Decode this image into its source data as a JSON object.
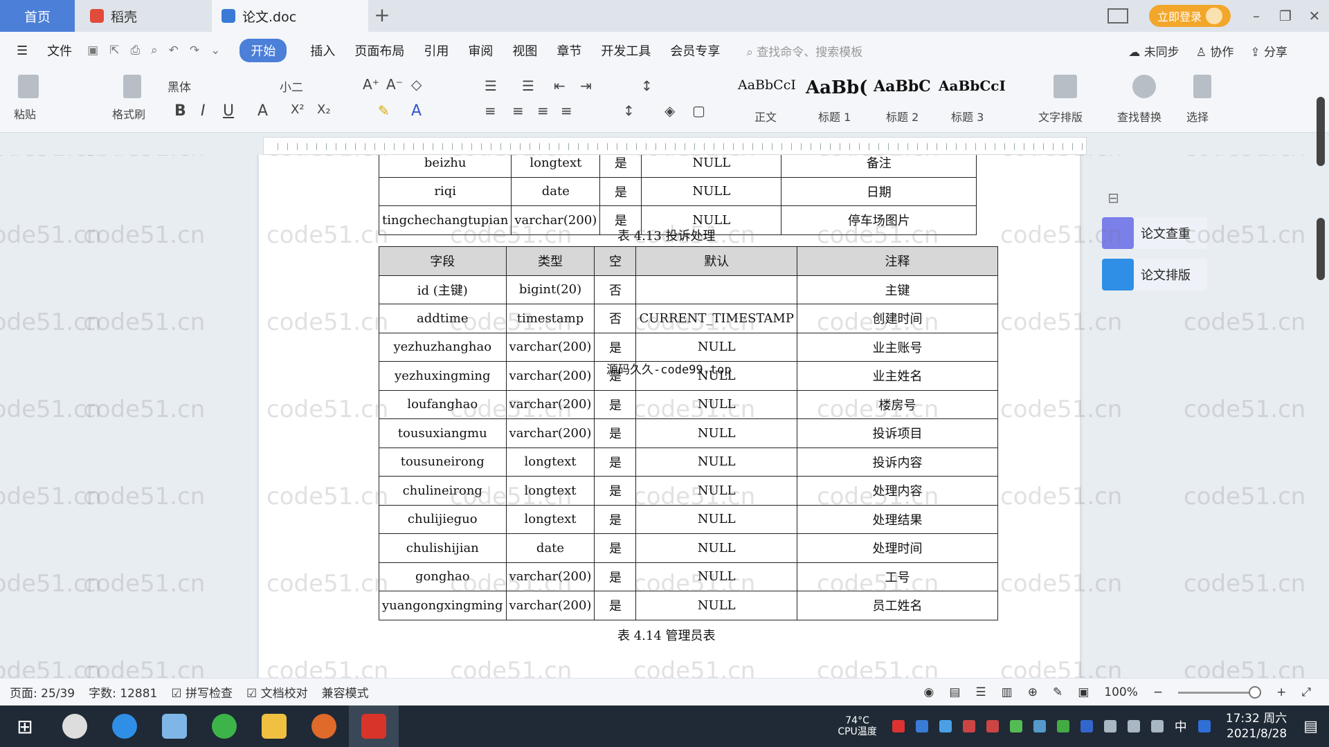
{
  "tabs": {
    "home": "首页",
    "daoke": "稻壳",
    "doc": "论文.doc"
  },
  "window": {
    "login_button": "立即登录"
  },
  "menu": {
    "file": "文件",
    "items": [
      "开始",
      "插入",
      "页面布局",
      "引用",
      "审阅",
      "视图",
      "章节",
      "开发工具",
      "会员专享"
    ],
    "search_placeholder": "查找命令、搜索模板",
    "sync": "未同步",
    "collab": "协作",
    "share": "分享"
  },
  "ribbon": {
    "paste": "粘贴",
    "format_painter": "格式刷",
    "font": "黑体",
    "font_size": "小二",
    "style_previews": [
      "AaBbCcI",
      "AaBb(",
      "AaBbC",
      "AaBbCcI"
    ],
    "style_names": [
      "正文",
      "标题 1",
      "标题 2",
      "标题 3"
    ],
    "text_layout": "文字排版",
    "find_replace": "查找替换",
    "select": "选择"
  },
  "prev_table": {
    "rows": [
      [
        "beizhu",
        "longtext",
        "是",
        "NULL",
        "备注"
      ],
      [
        "riqi",
        "date",
        "是",
        "NULL",
        "日期"
      ],
      [
        "tingchechangtupian",
        "varchar(200)",
        "是",
        "NULL",
        "停车场图片"
      ]
    ]
  },
  "captions": {
    "t413": "表 4.13  投诉处理",
    "t414": "表 4.14  管理员表"
  },
  "main_table": {
    "headers": [
      "字段",
      "类型",
      "空",
      "默认",
      "注释"
    ],
    "rows": [
      [
        "id (主键)",
        "bigint(20)",
        "否",
        "",
        "主键"
      ],
      [
        "addtime",
        "timestamp",
        "否",
        "CURRENT_TIMESTAMP",
        "创建时间"
      ],
      [
        "yezhuzhanghao",
        "varchar(200)",
        "是",
        "NULL",
        "业主账号"
      ],
      [
        "yezhuxingming",
        "varchar(200)",
        "是",
        "NULL",
        "业主姓名"
      ],
      [
        "loufanghao",
        "varchar(200)",
        "是",
        "NULL",
        "楼房号"
      ],
      [
        "tousuxiangmu",
        "varchar(200)",
        "是",
        "NULL",
        "投诉项目"
      ],
      [
        "tousuneirong",
        "longtext",
        "是",
        "NULL",
        "投诉内容"
      ],
      [
        "chulineirong",
        "longtext",
        "是",
        "NULL",
        "处理内容"
      ],
      [
        "chulijieguo",
        "longtext",
        "是",
        "NULL",
        "处理结果"
      ],
      [
        "chulishijian",
        "date",
        "是",
        "NULL",
        "处理时间"
      ],
      [
        "gonghao",
        "varchar(200)",
        "是",
        "NULL",
        "工号"
      ],
      [
        "yuangongxingming",
        "varchar(200)",
        "是",
        "NULL",
        "员工姓名"
      ]
    ]
  },
  "overlay_text": "源码久久-code99.top",
  "watermark": "code51.cn",
  "side_panel": {
    "check": "论文查重",
    "format": "论文排版"
  },
  "status": {
    "page": "页面: 25/39",
    "words": "字数: 12881",
    "spell": "拼写检查",
    "proof": "文档校对",
    "compat": "兼容模式",
    "zoom": "100%"
  },
  "taskbar": {
    "temp": "74°C",
    "cpu": "CPU温度",
    "ime": "中",
    "time": "17:32 周六",
    "date": "2021/8/28"
  },
  "colors": {
    "accent": "#4b7fd8",
    "login": "#f2a72b",
    "taskbar": "#1f2a36"
  }
}
